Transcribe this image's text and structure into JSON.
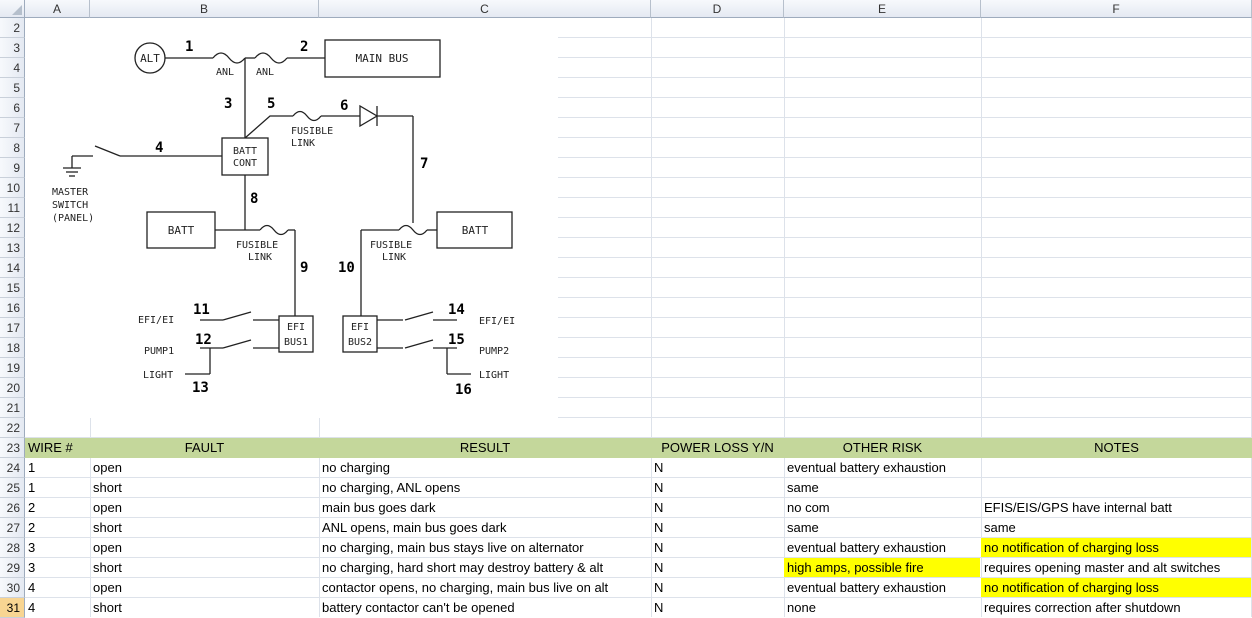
{
  "columns": [
    "A",
    "B",
    "C",
    "D",
    "E",
    "F"
  ],
  "rows": [
    "2",
    "3",
    "4",
    "5",
    "6",
    "7",
    "8",
    "9",
    "10",
    "11",
    "12",
    "13",
    "14",
    "15",
    "16",
    "17",
    "18",
    "19",
    "20",
    "21",
    "22",
    "23",
    "24",
    "25",
    "26",
    "27",
    "28",
    "29",
    "30",
    "31"
  ],
  "active_row": "31",
  "diagram": {
    "labels": {
      "alt": "ALT",
      "main_bus": "MAIN BUS",
      "anl1": "ANL",
      "anl2": "ANL",
      "batt_cont_1": "BATT",
      "batt_cont_2": "CONT",
      "fusible1_1": "FUSIBLE",
      "fusible1_2": "LINK",
      "fusible2_1": "FUSIBLE",
      "fusible2_2": "LINK",
      "fusible3_1": "FUSIBLE",
      "fusible3_2": "LINK",
      "master1": "MASTER",
      "master2": "SWITCH",
      "master3": "(PANEL)",
      "batt_left": "BATT",
      "batt_right": "BATT",
      "efi_bus1_1": "EFI",
      "efi_bus1_2": "BUS1",
      "efi_bus2_1": "EFI",
      "efi_bus2_2": "BUS2",
      "efi_ei_left": "EFI/EI",
      "pump1": "PUMP1",
      "light_left": "LIGHT",
      "efi_ei_right": "EFI/EI",
      "pump2": "PUMP2",
      "light_right": "LIGHT"
    },
    "wire_numbers": [
      "1",
      "2",
      "3",
      "4",
      "5",
      "6",
      "7",
      "8",
      "9",
      "10",
      "11",
      "12",
      "13",
      "14",
      "15",
      "16"
    ]
  },
  "table": {
    "headers": [
      "WIRE #",
      "FAULT",
      "RESULT",
      "POWER LOSS Y/N",
      "OTHER RISK",
      "NOTES"
    ],
    "rows": [
      {
        "wire": "1",
        "fault": "open",
        "result": "no charging",
        "loss": "N",
        "risk": "eventual battery exhaustion",
        "notes": ""
      },
      {
        "wire": "1",
        "fault": "short",
        "result": "no charging, ANL opens",
        "loss": "N",
        "risk": "same",
        "notes": ""
      },
      {
        "wire": "2",
        "fault": "open",
        "result": "main bus goes dark",
        "loss": "N",
        "risk": "no com",
        "notes": "EFIS/EIS/GPS have internal batt"
      },
      {
        "wire": "2",
        "fault": "short",
        "result": "ANL opens, main bus goes dark",
        "loss": "N",
        "risk": "same",
        "notes": "same"
      },
      {
        "wire": "3",
        "fault": "open",
        "result": "no charging, main bus stays live on alternator",
        "loss": "N",
        "risk": "eventual battery exhaustion",
        "notes": "no notification of charging loss"
      },
      {
        "wire": "3",
        "fault": "short",
        "result": "no charging, hard short may destroy battery & alt",
        "loss": "N",
        "risk": "high amps, possible fire",
        "notes": "requires opening master and alt switches"
      },
      {
        "wire": "4",
        "fault": "open",
        "result": "contactor opens, no charging, main bus live on alt",
        "loss": "N",
        "risk": "eventual battery exhaustion",
        "notes": "no notification of charging loss"
      },
      {
        "wire": "4",
        "fault": "short",
        "result": "battery contactor can't be opened",
        "loss": "N",
        "risk": "none",
        "notes": "requires correction after shutdown"
      }
    ]
  },
  "highlight_color": "#ffff00",
  "header_row_color": "#c4d79b"
}
